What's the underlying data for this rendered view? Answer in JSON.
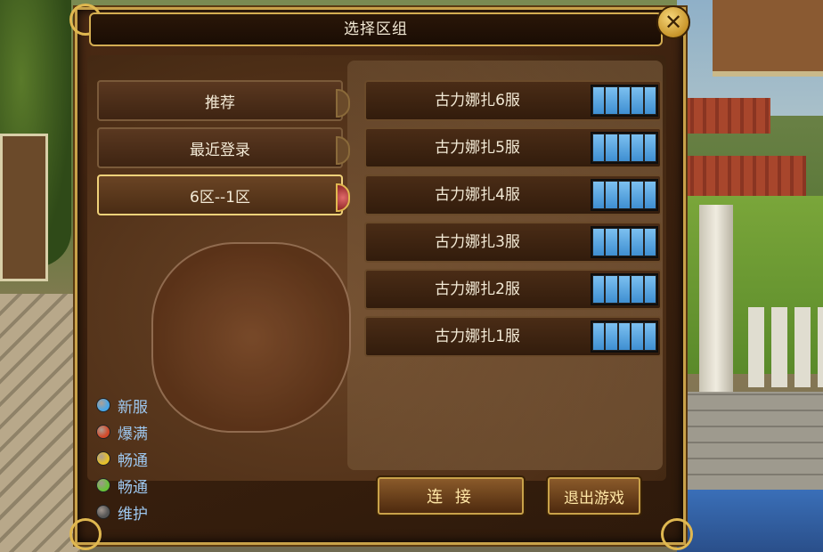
{
  "dialog": {
    "title": "选择区组",
    "close_symbol": "✕"
  },
  "categories": [
    {
      "label": "推荐",
      "active": false
    },
    {
      "label": "最近登录",
      "active": false
    },
    {
      "label": "6区--1区",
      "active": true
    }
  ],
  "servers": [
    {
      "name": "古力娜扎6服",
      "load_bars": 5
    },
    {
      "name": "古力娜扎5服",
      "load_bars": 5
    },
    {
      "name": "古力娜扎4服",
      "load_bars": 5
    },
    {
      "name": "古力娜扎3服",
      "load_bars": 5
    },
    {
      "name": "古力娜扎2服",
      "load_bars": 5
    },
    {
      "name": "古力娜扎1服",
      "load_bars": 5
    }
  ],
  "legend": [
    {
      "label": "新服",
      "color": "#4aa6e6"
    },
    {
      "label": "爆满",
      "color": "#d24a2a"
    },
    {
      "label": "畅通",
      "color": "#e6c02a"
    },
    {
      "label": "畅通",
      "color": "#6ac23a"
    },
    {
      "label": "维护",
      "color": "#555555"
    }
  ],
  "buttons": {
    "connect": "连 接",
    "exit": "退出游戏"
  }
}
